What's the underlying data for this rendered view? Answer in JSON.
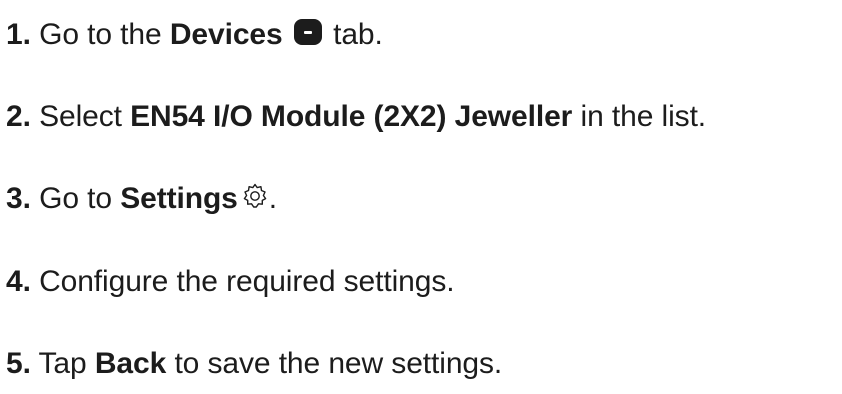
{
  "steps": [
    {
      "number": "1.",
      "parts": {
        "a": "Go to the",
        "b": "Devices",
        "c": "tab."
      },
      "icon": "devices-icon"
    },
    {
      "number": "2.",
      "parts": {
        "a": "Select",
        "b": "EN54 I/O Module (2X2) Jeweller",
        "c": "in the list."
      }
    },
    {
      "number": "3.",
      "parts": {
        "a": "Go to",
        "b": "Settings",
        "c": "."
      },
      "icon": "gear-icon"
    },
    {
      "number": "4.",
      "parts": {
        "a": "Configure the required settings."
      }
    },
    {
      "number": "5.",
      "parts": {
        "a": "Tap",
        "b": "Back",
        "c": "to save the new settings."
      }
    }
  ],
  "colors": {
    "text": "#1c1c1c",
    "icon": "#1c1c1c"
  }
}
